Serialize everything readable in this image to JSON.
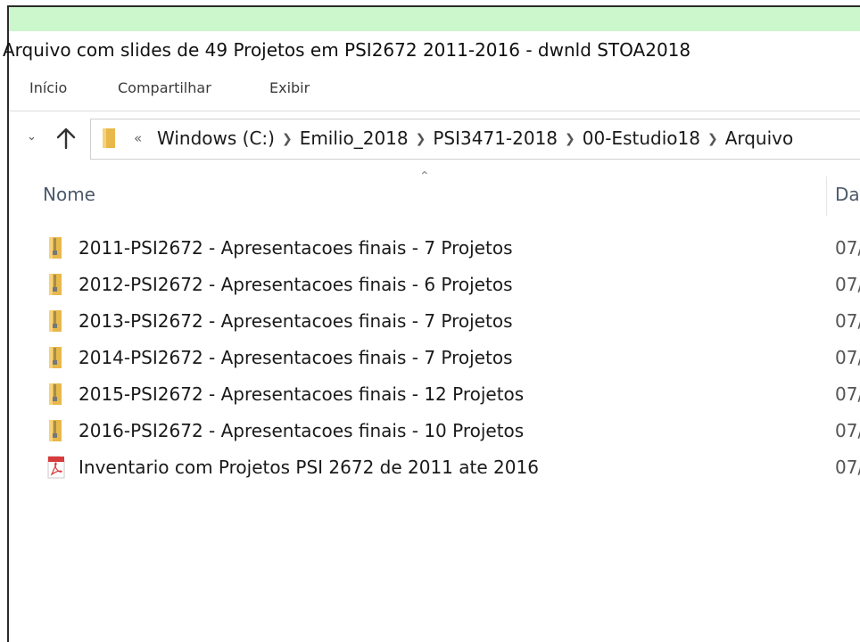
{
  "window": {
    "title": "Arquivo com slides de 49 Projetos em PSI2672 2011-2016 - dwnld STOA2018"
  },
  "ribbon": {
    "tabs": [
      "Início",
      "Compartilhar",
      "Exibir"
    ]
  },
  "address": {
    "overflow": "«",
    "crumbs": [
      "Windows (C:)",
      "Emilio_2018",
      "PSI3471-2018",
      "00-Estudio18",
      "Arquivo"
    ]
  },
  "columns": {
    "name": "Nome",
    "date": "Da"
  },
  "files": [
    {
      "name": "2011-PSI2672 - Apresentacoes finais - 7 Projetos",
      "date": "07/",
      "icon": "zip-folder-icon"
    },
    {
      "name": "2012-PSI2672 - Apresentacoes finais - 6 Projetos",
      "date": "07/",
      "icon": "zip-folder-icon"
    },
    {
      "name": "2013-PSI2672 - Apresentacoes finais - 7 Projetos",
      "date": "07/",
      "icon": "zip-folder-icon"
    },
    {
      "name": "2014-PSI2672 - Apresentacoes finais - 7 Projetos",
      "date": "07/",
      "icon": "zip-folder-icon"
    },
    {
      "name": "2015-PSI2672 - Apresentacoes finais - 12 Projetos",
      "date": "07/",
      "icon": "zip-folder-icon"
    },
    {
      "name": "2016-PSI2672 - Apresentacoes finais - 10 Projetos",
      "date": "07/",
      "icon": "zip-folder-icon"
    },
    {
      "name": "Inventario com Projetos PSI 2672 de 2011 ate 2016",
      "date": "07/",
      "icon": "pdf-icon"
    }
  ],
  "colors": {
    "title_bar": "#ccf7cc",
    "folder": "#e8b84a",
    "pdf": "#d83b3b"
  }
}
